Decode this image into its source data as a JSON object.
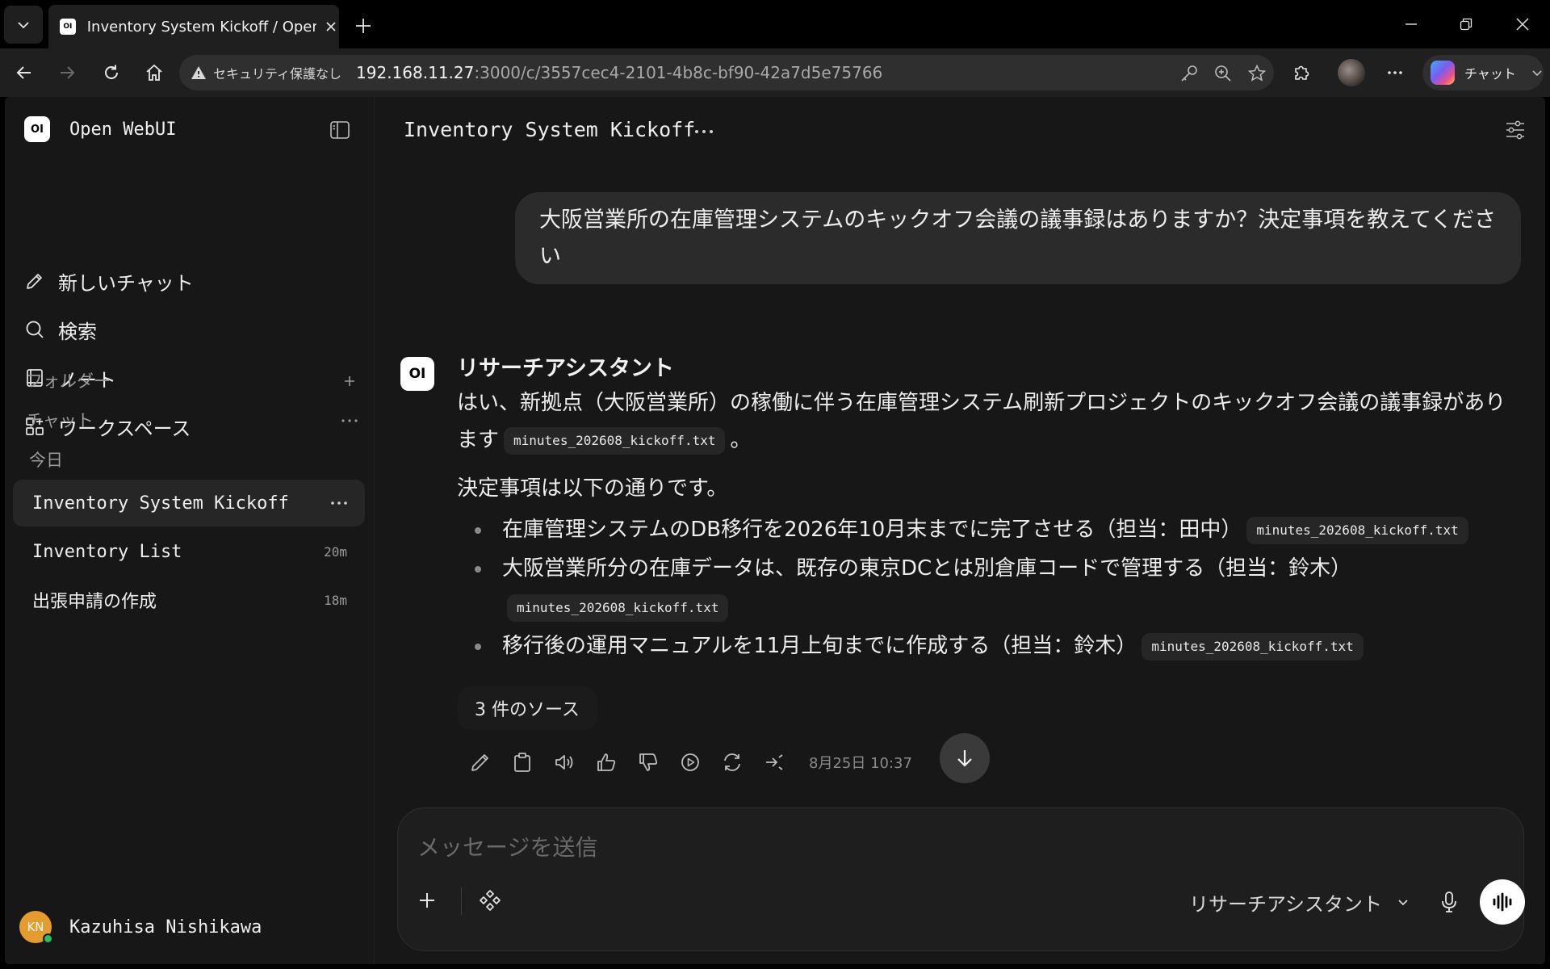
{
  "browser": {
    "tab_title": "Inventory System Kickoff / Open WebUI",
    "tab_favicon": "OI",
    "security_label": "セキュリティ保護なし",
    "url_host": "192.168.11.27",
    "url_rest": ":3000/c/3557cec4-2101-4b8c-bf90-42a7d5e75766",
    "copilot_label": "チャット"
  },
  "sidebar": {
    "brand_logo": "OI",
    "brand_name": "Open WebUI",
    "nav": [
      {
        "label": "新しいチャット",
        "icon": "pencil-icon"
      },
      {
        "label": "検索",
        "icon": "search-icon"
      },
      {
        "label": "ノート",
        "icon": "notebook-icon"
      },
      {
        "label": "ワークスペース",
        "icon": "grid-icon"
      }
    ],
    "folders_label": "フォルダー",
    "chats_label": "チャット",
    "today_label": "今日",
    "chats": [
      {
        "title": "Inventory System Kickoff",
        "meta": ""
      },
      {
        "title": "Inventory List",
        "meta": "20m"
      },
      {
        "title": "出張申請の作成",
        "meta": "18m"
      }
    ],
    "user": {
      "initials": "KN",
      "name": "Kazuhisa Nishikawa"
    }
  },
  "chat": {
    "title": "Inventory System Kickoff",
    "user_message": "大阪営業所の在庫管理システムのキックオフ会議の議事録はありますか？決定事項を教えてください",
    "assistant_avatar": "OI",
    "assistant_name": "リサーチアシスタント",
    "intro": "はい、新拠点（大阪営業所）の稼働に伴う在庫管理システム刷新プロジェクトのキックオフ会議の議事録があります",
    "intro_citation": "minutes_202608_kickoff.txt",
    "intro_end": "。",
    "decisions_lead": "決定事項は以下の通りです。",
    "decisions": [
      {
        "text": "在庫管理システムのDB移行を2026年10月末までに完了させる（担当：田中）",
        "citation": "minutes_202608_kickoff.txt"
      },
      {
        "text": "大阪営業所分の在庫データは、既存の東京DCとは別倉庫コードで管理する（担当：鈴木）",
        "citation": "minutes_202608_kickoff.txt"
      },
      {
        "text": "移行後の運用マニュアルを11月上旬までに作成する（担当：鈴木）",
        "citation": "minutes_202608_kickoff.txt"
      }
    ],
    "sources_label": "3 件のソース",
    "timestamp": "8月25日 10:37"
  },
  "composer": {
    "placeholder": "メッセージを送信",
    "model_label": "リサーチアシスタント"
  },
  "colors": {
    "background": "#171717",
    "bubble": "#2b2b2b",
    "status_online": "#24c35a",
    "avatar": "#e59b2e"
  }
}
